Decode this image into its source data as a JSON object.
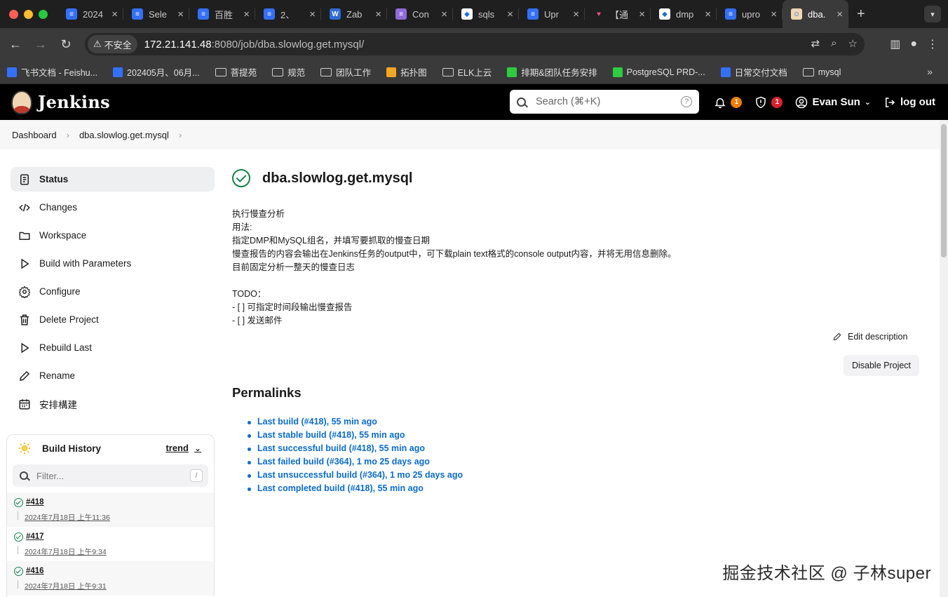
{
  "browser": {
    "colors": {
      "close": "#ff5f57",
      "minimize": "#febc2e",
      "maximize": "#28c840"
    },
    "tabs": [
      {
        "title": "2024",
        "color": "#3370ff",
        "glyph": "≡"
      },
      {
        "title": "Sele",
        "color": "#3370ff",
        "glyph": "≡"
      },
      {
        "title": "百胜",
        "color": "#3370ff",
        "glyph": "≡"
      },
      {
        "title": "2、",
        "color": "#3370ff",
        "glyph": "≡"
      },
      {
        "title": "Zab",
        "color": "#2d6bd8",
        "glyph": "W"
      },
      {
        "title": "Con",
        "color": "#8e6bd8",
        "glyph": "≡"
      },
      {
        "title": "sqls",
        "color": "#ffffff",
        "glyph": "◆"
      },
      {
        "title": "Upr",
        "color": "#3370ff",
        "glyph": "≡"
      },
      {
        "title": "【通",
        "color": "#1f1f1f",
        "glyph": "♥"
      },
      {
        "title": "dmp",
        "color": "#ffffff",
        "glyph": "◆"
      },
      {
        "title": "upro",
        "color": "#3370ff",
        "glyph": "≡"
      },
      {
        "title": "dba.",
        "color": "#f0d6b5",
        "glyph": "☺"
      }
    ],
    "new_tab": "+",
    "insecure_label": "不安全",
    "url_host": "172.21.141.48",
    "url_path": ":8080/job/dba.slowlog.get.mysql/",
    "bookmarks": [
      {
        "label": "飞书文档 - Feishu...",
        "type": "icon",
        "color": "#3370ff"
      },
      {
        "label": "202405月、06月...",
        "type": "icon",
        "color": "#3370ff"
      },
      {
        "label": "菩提苑",
        "type": "folder"
      },
      {
        "label": "规范",
        "type": "folder"
      },
      {
        "label": "团队工作",
        "type": "folder"
      },
      {
        "label": "拓扑图",
        "type": "icon",
        "color": "#f5a623"
      },
      {
        "label": "ELK上云",
        "type": "folder"
      },
      {
        "label": "排期&团队任务安排",
        "type": "icon",
        "color": "#2ecc40"
      },
      {
        "label": "PostgreSQL PRD-...",
        "type": "icon",
        "color": "#2ecc40"
      },
      {
        "label": "日常交付文档",
        "type": "icon",
        "color": "#3370ff"
      },
      {
        "label": "mysql",
        "type": "folder"
      }
    ]
  },
  "jenkins": {
    "brand": "Jenkins",
    "search_placeholder": "Search (⌘+K)",
    "notifications_count": "1",
    "notifications_color": "#f07d00",
    "security_count": "1",
    "security_color": "#e0202e",
    "user_name": "Evan Sun",
    "logout_label": "log out"
  },
  "breadcrumb": {
    "items": [
      "Dashboard",
      "dba.slowlog.get.mysql"
    ]
  },
  "sidebar": {
    "items": [
      {
        "label": "Status",
        "icon": "status-icon",
        "active": true
      },
      {
        "label": "Changes",
        "icon": "code-icon"
      },
      {
        "label": "Workspace",
        "icon": "folder-icon"
      },
      {
        "label": "Build with Parameters",
        "icon": "play-icon"
      },
      {
        "label": "Configure",
        "icon": "gear-icon"
      },
      {
        "label": "Delete Project",
        "icon": "trash-icon"
      },
      {
        "label": "Rebuild Last",
        "icon": "play-icon"
      },
      {
        "label": "Rename",
        "icon": "pencil-icon"
      },
      {
        "label": "安排構建",
        "icon": "calendar-icon"
      }
    ]
  },
  "build_history": {
    "title": "Build History",
    "trend_label": "trend",
    "filter_placeholder": "Filter...",
    "filter_shortcut": "/",
    "builds": [
      {
        "number": "#418",
        "time": "2024年7月18日 上午11:36"
      },
      {
        "number": "#417",
        "time": "2024年7月18日 上午9:34"
      },
      {
        "number": "#416",
        "time": "2024年7月18日 上午9:31"
      }
    ]
  },
  "job": {
    "title": "dba.slowlog.get.mysql",
    "description_lines": [
      "执行慢查分析",
      "用法:",
      "指定DMP和MySQL组名，并填写要抓取的慢查日期",
      "慢查报告的内容会输出在Jenkins任务的output中，可下载plain text格式的console output内容，并将无用信息删除。",
      "目前固定分析一整天的慢查日志",
      "",
      "TODO：",
      "- [ ] 可指定时间段输出慢查报告",
      "- [ ] 发送邮件"
    ],
    "edit_description_label": "Edit description",
    "disable_label": "Disable Project",
    "permalinks_title": "Permalinks",
    "permalinks": [
      "Last build (#418), 55 min ago",
      "Last stable build (#418), 55 min ago",
      "Last successful build (#418), 55 min ago",
      "Last failed build (#364), 1 mo 25 days ago",
      "Last unsuccessful build (#364), 1 mo 25 days ago",
      "Last completed build (#418), 55 min ago"
    ]
  },
  "watermark": "掘金技术社区 @ 子林super"
}
